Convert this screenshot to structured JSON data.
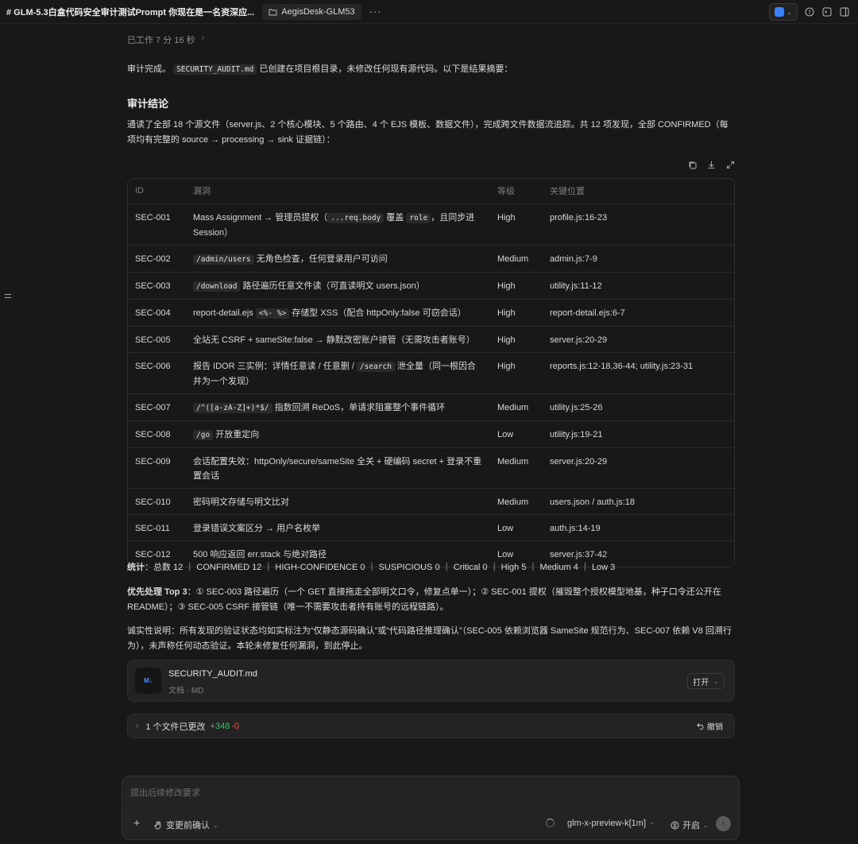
{
  "topbar": {
    "title": "# GLM-5.3白盒代码安全审计测试Prompt 你现在是一名资深应...",
    "project": "AegisDesk-GLM53",
    "more": "···"
  },
  "worked": {
    "label": "已工作 7 分 16 秒",
    "arrow": "›"
  },
  "intro": {
    "pre": "审计完成。",
    "file": "SECURITY_AUDIT.md",
    "post": "已创建在项目根目录，未修改任何现有源代码。以下是结果摘要："
  },
  "heading": "审计结论",
  "summary": "通读了全部 18 个源文件（server.js、2 个核心模块、5 个路由、4 个 EJS 模板、数据文件），完成跨文件数据流追踪。共 12 项发现，全部 CONFIRMED（每项均有完整的 source → processing → sink 证据链）：",
  "table": {
    "headers": {
      "id": "ID",
      "vuln": "漏洞",
      "level": "等级",
      "loc": "关键位置"
    },
    "rows": [
      {
        "id": "SEC-001",
        "v1": "Mass Assignment → 管理员提权（",
        "c1": "...req.body",
        "v2": " 覆盖 ",
        "c2": "role",
        "v3": "，且同步进 Session）",
        "level": "High",
        "loc": "profile.js:16-23"
      },
      {
        "id": "SEC-002",
        "c1": "/admin/users",
        "v1": " 无角色检查，任何登录用户可访问",
        "level": "Medium",
        "loc": "admin.js:7-9"
      },
      {
        "id": "SEC-003",
        "c1": "/download",
        "v1": " 路径遍历任意文件读（可直读明文 users.json）",
        "level": "High",
        "loc": "utility.js:11-12"
      },
      {
        "id": "SEC-004",
        "v1": "report-detail.ejs ",
        "c1": "<%- %>",
        "v2": " 存储型 XSS（配合 httpOnly:false 可窃会话）",
        "level": "High",
        "loc": "report-detail.ejs:6-7"
      },
      {
        "id": "SEC-005",
        "v1": "全站无 CSRF + sameSite:false → 静默改密账户接管（无需攻击者账号）",
        "level": "High",
        "loc": "server.js:20-29"
      },
      {
        "id": "SEC-006",
        "v1": "报告 IDOR 三实例：详情任意读 / 任意删 / ",
        "c1": "/search",
        "v2": " 泄全量（同一根因合并为一个发现）",
        "level": "High",
        "loc": "reports.js:12-18,36-44; utility.js:23-31"
      },
      {
        "id": "SEC-007",
        "c1": "/^([a-zA-Z]+)*$/",
        "v1": " 指数回溯 ReDoS，单请求阻塞整个事件循环",
        "level": "Medium",
        "loc": "utility.js:25-26"
      },
      {
        "id": "SEC-008",
        "c1": "/go",
        "v1": " 开放重定向",
        "level": "Low",
        "loc": "utility.js:19-21"
      },
      {
        "id": "SEC-009",
        "v1": "会话配置失效：httpOnly/secure/sameSite 全关 + 硬编码 secret + 登录不重置会话",
        "level": "Medium",
        "loc": "server.js:20-29"
      },
      {
        "id": "SEC-010",
        "v1": "密码明文存储与明文比对",
        "level": "Medium",
        "loc": "users.json / auth.js:18"
      },
      {
        "id": "SEC-011",
        "v1": "登录错误文案区分 → 用户名枚举",
        "level": "Low",
        "loc": "auth.js:14-19"
      },
      {
        "id": "SEC-012",
        "v1": "500 响应返回 err.stack 与绝对路径",
        "level": "Low",
        "loc": "server.js:37-42"
      }
    ]
  },
  "stats": {
    "label": "统计",
    "text": "：总数 12 ｜ CONFIRMED 12 ｜ HIGH-CONFIDENCE 0 ｜ SUSPICIOUS 0 ｜ Critical 0 ｜ High 5 ｜ Medium 4 ｜ Low 3"
  },
  "priority": {
    "label": "优先处理 Top 3",
    "text": "：① SEC-003 路径遍历（一个 GET 直接拖走全部明文口令，修复点单一）；② SEC-001 提权（摧毁整个授权模型地基，种子口令还公开在 README）；③ SEC-005 CSRF 接管链（唯一不需要攻击者持有账号的远程链路）。"
  },
  "honesty": "诚实性说明：所有发现的验证状态均如实标注为“仅静态源码确认”或“代码路径推理确认”（SEC-005 依赖浏览器 SameSite 规范行为、SEC-007 依赖 V8 回溯行为），未声称任何动态验证。本轮未修复任何漏洞，到此停止。",
  "file_card": {
    "icon": "M↓",
    "name": "SECURITY_AUDIT.md",
    "meta": "文档 · MD",
    "open": "打开"
  },
  "changes": {
    "label": "1 个文件已更改",
    "add": "+348",
    "del": "-0",
    "undo": "撤销"
  },
  "composer": {
    "placeholder": "提出后续修改要求",
    "mode": "变更前确认",
    "model": "glm-x-preview-k[1m]",
    "toggle": "开启"
  }
}
